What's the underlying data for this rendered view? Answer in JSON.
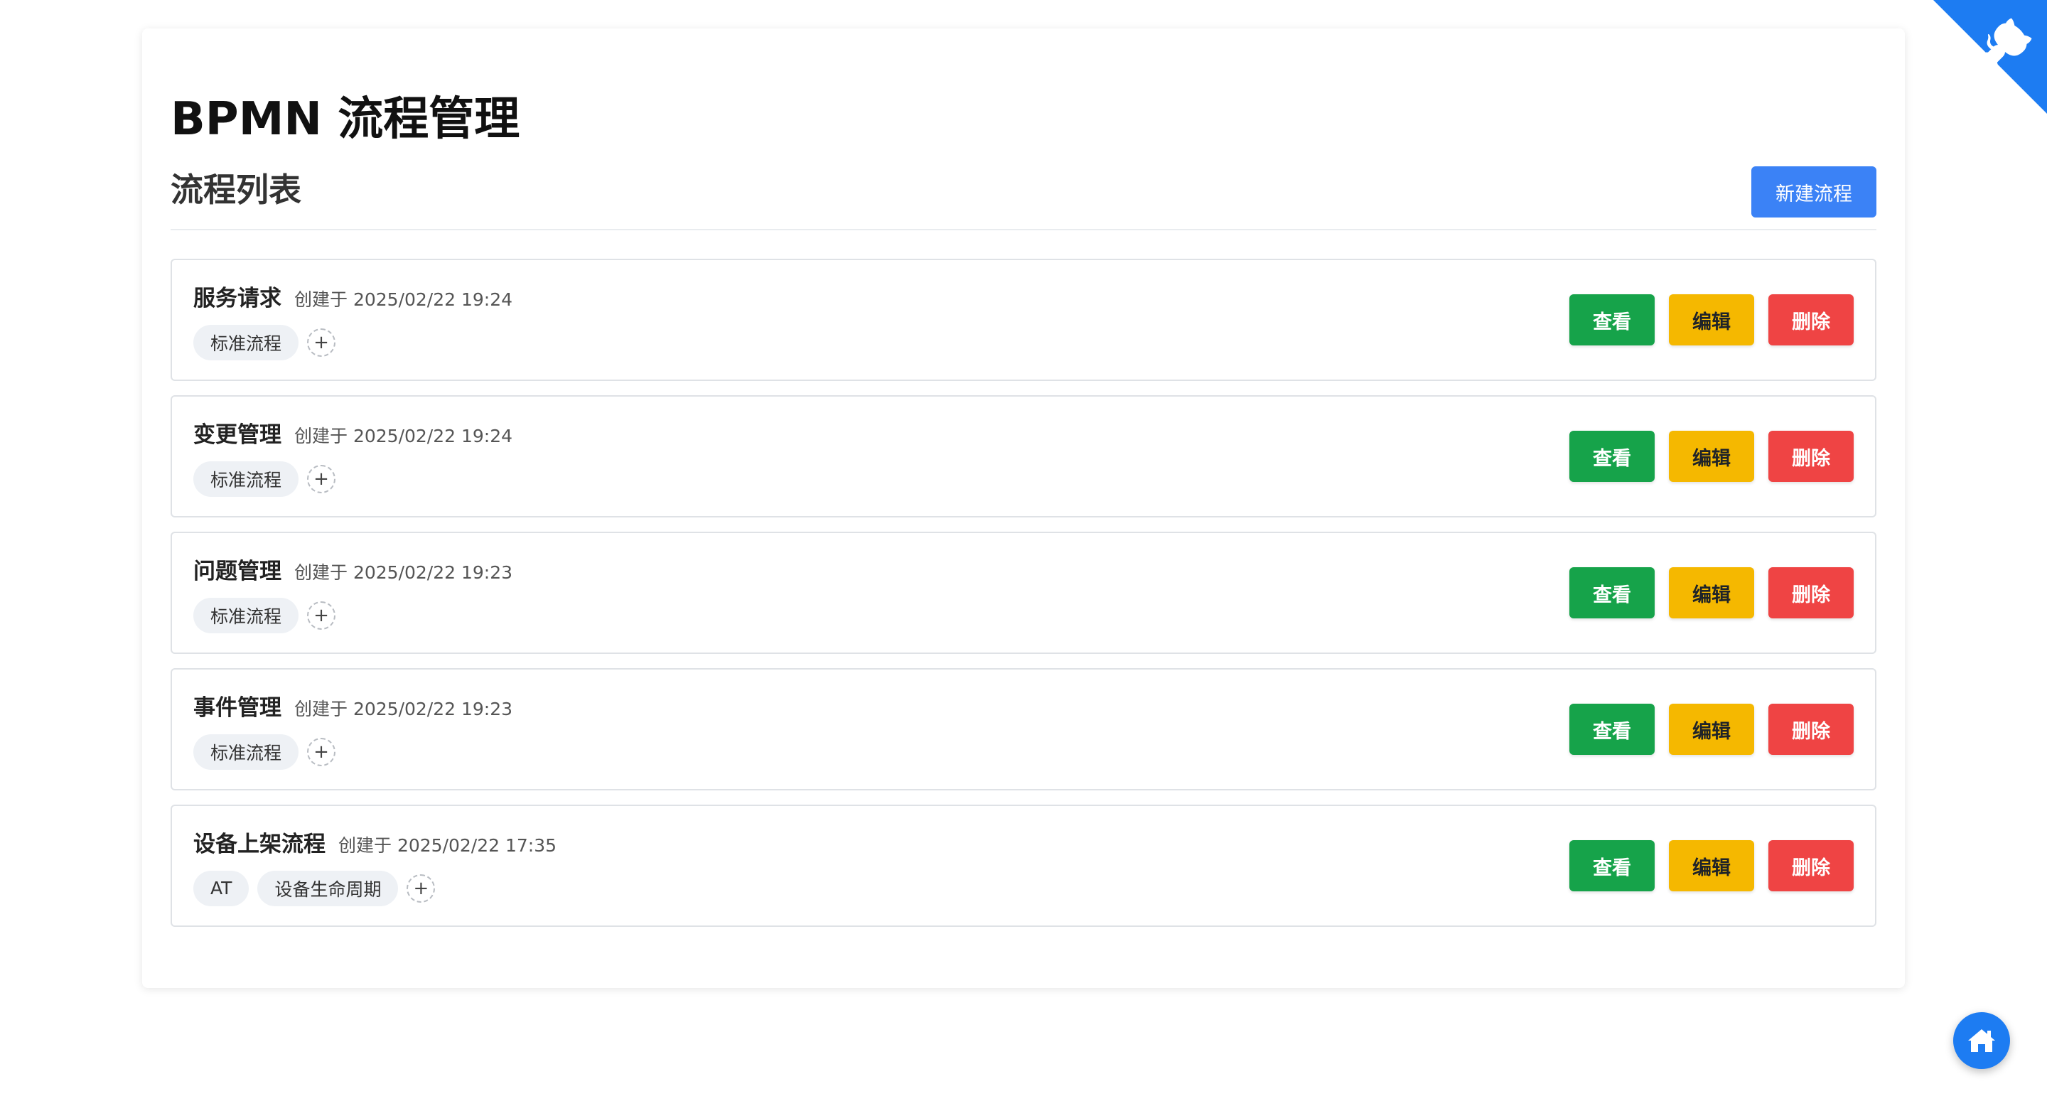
{
  "page": {
    "title": "BPMN 流程管理"
  },
  "section": {
    "title": "流程列表",
    "new_button": "新建流程"
  },
  "actions": {
    "view": "查看",
    "edit": "编辑",
    "delete": "删除"
  },
  "add_tag_symbol": "+",
  "processes": [
    {
      "name": "服务请求",
      "created": "创建于 2025/02/22 19:24",
      "tags": [
        "标准流程"
      ]
    },
    {
      "name": "变更管理",
      "created": "创建于 2025/02/22 19:24",
      "tags": [
        "标准流程"
      ]
    },
    {
      "name": "问题管理",
      "created": "创建于 2025/02/22 19:23",
      "tags": [
        "标准流程"
      ]
    },
    {
      "name": "事件管理",
      "created": "创建于 2025/02/22 19:23",
      "tags": [
        "标准流程"
      ]
    },
    {
      "name": "设备上架流程",
      "created": "创建于 2025/02/22 17:35",
      "tags": [
        "AT",
        "设备生命周期"
      ]
    }
  ],
  "icons": {
    "corner": "octocat-corner-icon",
    "home": "home-icon"
  },
  "colors": {
    "primary": "#3b82f6",
    "view": "#16a34a",
    "edit": "#f5b800",
    "delete": "#ef4444",
    "fab": "#1d7cf2"
  }
}
